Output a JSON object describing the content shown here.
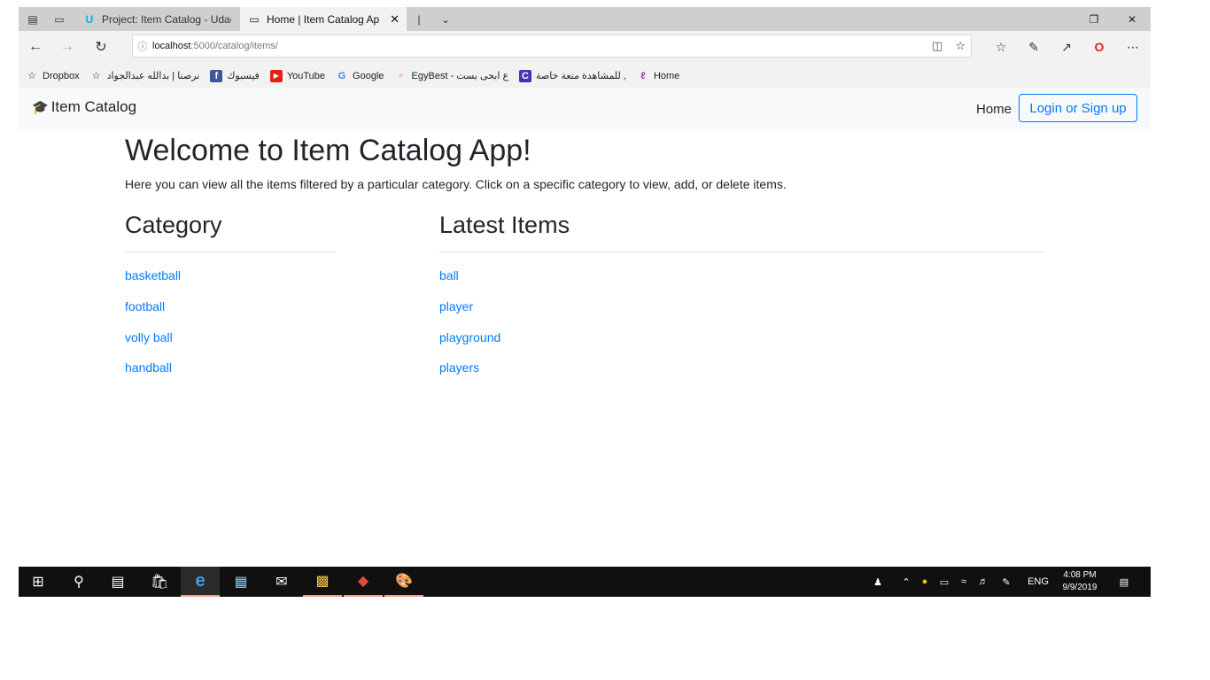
{
  "browser": {
    "tabs": [
      {
        "title": "Project: Item Catalog - Udac",
        "icon": "udacity-icon",
        "active": false
      },
      {
        "title": "Home | Item Catalog Ap",
        "icon": "page-icon",
        "active": true
      }
    ],
    "address": {
      "host": "localhost",
      "path": ":5000/catalog/items/"
    },
    "favorites": [
      {
        "label": "Dropbox",
        "icon": "star-icon"
      },
      {
        "label": "نرصنا | بدالله عبدالجواد",
        "icon": "star-icon"
      },
      {
        "label": "فيسبوك",
        "icon": "facebook-icon"
      },
      {
        "label": "YouTube",
        "icon": "youtube-icon"
      },
      {
        "label": "Google",
        "icon": "google-icon"
      },
      {
        "label": "EgyBest - ع ابحى بست",
        "icon": "egybest-icon"
      },
      {
        "label": "للمشاهدة متعة خاصة ,",
        "icon": "c-icon"
      },
      {
        "label": "Home",
        "icon": "home-bookmark-icon"
      }
    ]
  },
  "navbar": {
    "brand": "Item Catalog",
    "home": "Home",
    "login": "Login or Sign up"
  },
  "main": {
    "title": "Welcome to Item Catalog App!",
    "lead": "Here you can view all the items filtered by a particular category. Click on a specific category to view, add, or delete items.",
    "category_heading": "Category",
    "latest_heading": "Latest Items",
    "categories": [
      "basketball",
      "football",
      "volly ball",
      "handball"
    ],
    "latest_items": [
      "ball",
      "player",
      "playground",
      "players"
    ]
  },
  "taskbar": {
    "lang": "ENG",
    "time": "4:08 PM",
    "date": "9/9/2019"
  },
  "colors": {
    "link": "#007bff",
    "navbar_bg": "#f8f9fa",
    "taskbar_bg": "#101010"
  }
}
